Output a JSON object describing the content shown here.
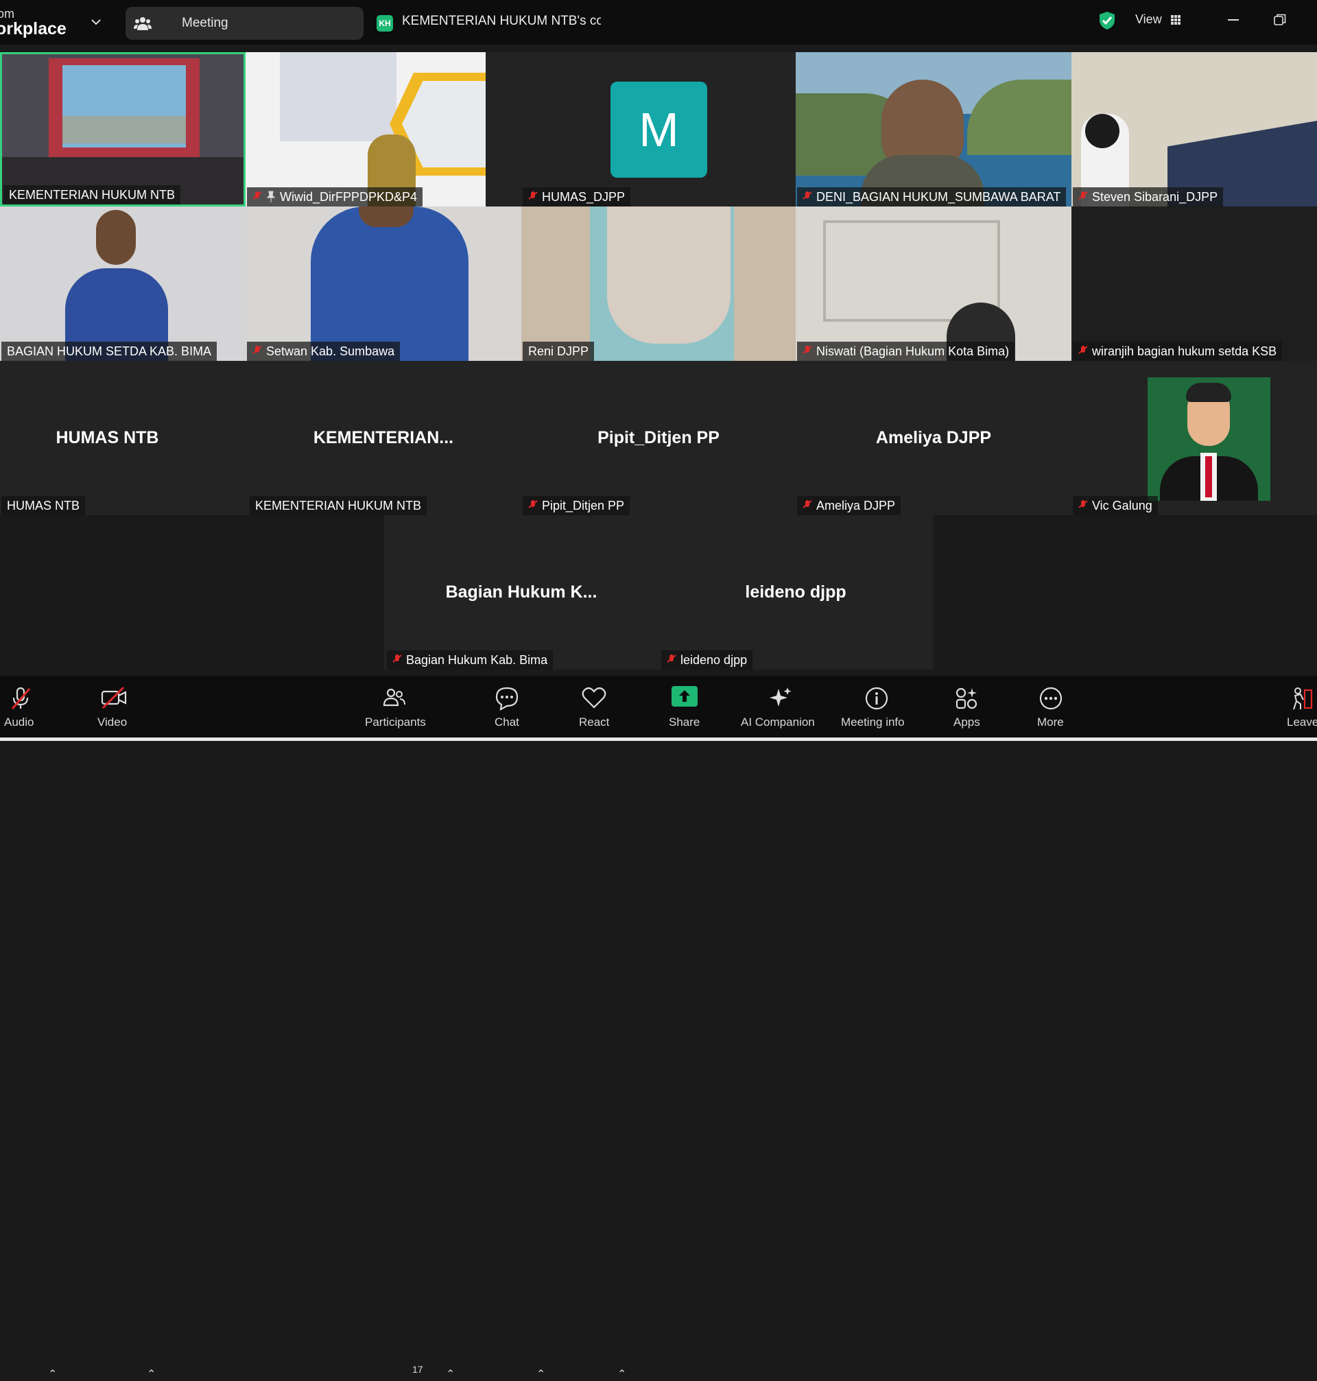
{
  "titlebar": {
    "brand_line1": "om",
    "brand_line2": "orkplace",
    "meeting_tab": "Meeting",
    "app_initials": "KH",
    "window_title": "KEMENTERIAN HUKUM NTB's compu",
    "view_label": "View"
  },
  "tiles": {
    "t1": "KEMENTERIAN HUKUM NTB",
    "t2": "Wiwid_DirFPPDPKD&P4",
    "t3": "HUMAS_DJPP",
    "t3_avatar": "M",
    "t4": "DENI_BAGIAN HUKUM_SUMBAWA BARAT",
    "t5": "Steven Sibarani_DJPP",
    "t6": "BAGIAN HUKUM SETDA KAB. BIMA",
    "t7": "Setwan Kab. Sumbawa",
    "t8": "Reni DJPP",
    "t9": "Niswati (Bagian Hukum Kota Bima)",
    "t10": "wiranjih bagian hukum setda KSB",
    "t11_big": "HUMAS NTB",
    "t11": "HUMAS NTB",
    "t12_big": "KEMENTERIAN...",
    "t12": "KEMENTERIAN HUKUM NTB",
    "t13_big": "Pipit_Ditjen PP",
    "t13": "Pipit_Ditjen PP",
    "t14_big": "Ameliya DJPP",
    "t14": "Ameliya DJPP",
    "t15": "Vic Galung",
    "t16_big": "Bagian  Hukum  K...",
    "t16": "Bagian Hukum Kab. Bima",
    "t17_big": "leideno djpp",
    "t17": "leideno djpp"
  },
  "toolbar": {
    "audio": "Audio",
    "video": "Video",
    "participants": "Participants",
    "participant_count": "17",
    "chat": "Chat",
    "react": "React",
    "share": "Share",
    "ai": "AI Companion",
    "info": "Meeting info",
    "apps": "Apps",
    "more": "More",
    "leave": "Leave"
  },
  "colors": {
    "accent_green": "#1db874",
    "mute_red": "#e02828",
    "avatar_teal": "#14a8a8",
    "active_border": "#35d07f"
  }
}
